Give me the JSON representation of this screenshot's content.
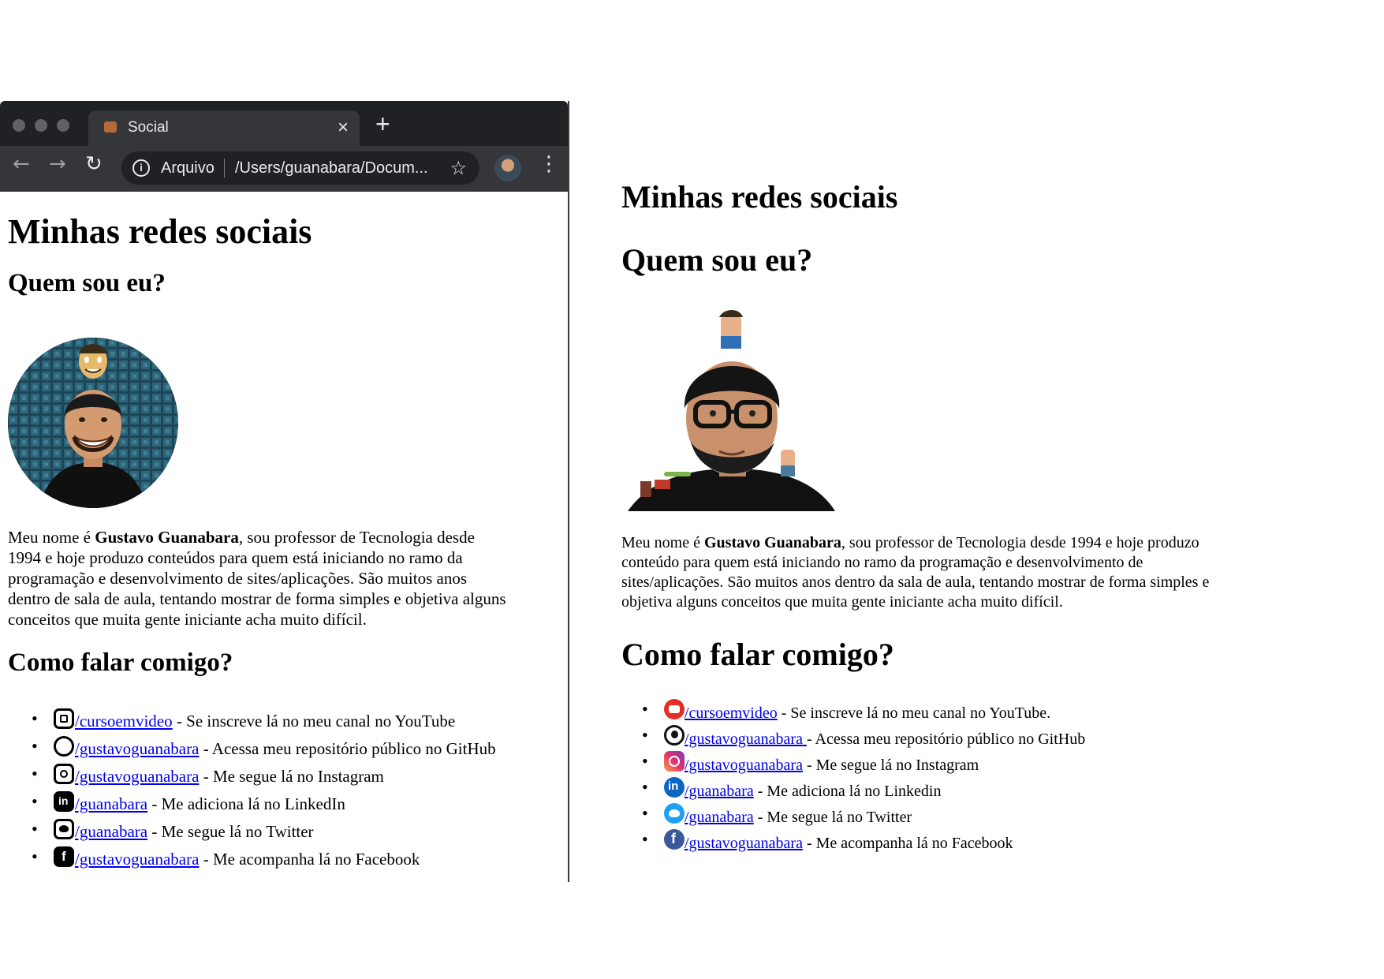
{
  "browser": {
    "tab_title": "Social",
    "address_label": "Arquivo",
    "address_url": "/Users/guanabara/Docum..."
  },
  "left": {
    "h1": "Minhas redes sociais",
    "h2_about": "Quem sou eu?",
    "bio_before": "Meu nome é ",
    "bio_name": "Gustavo Guanabara",
    "bio_line1": ", sou professor de Tecnologia desde",
    "bio_line2": "1994 e hoje produzo conteúdos para quem está iniciando no ramo da",
    "bio_line3": "programação e desenvolvimento de sites/aplicações. São muitos anos",
    "bio_line4": "dentro de sala de aula, tentando mostrar de forma simples e objetiva alguns",
    "bio_line5": "conceitos que muita gente iniciante acha muito difícil.",
    "h2_contact": "Como falar comigo?",
    "links": [
      {
        "icon": "youtube-icon",
        "handle": "/cursoemvideo",
        "text": " - Se inscreve lá no meu canal no YouTube"
      },
      {
        "icon": "github-icon",
        "handle": "/gustavoguanabara",
        "text": " - Acessa meu repositório público no GitHub"
      },
      {
        "icon": "instagram-icon",
        "handle": "/gustavoguanabara",
        "text": " - Me segue lá no Instagram"
      },
      {
        "icon": "linkedin-icon",
        "handle": "/guanabara",
        "text": " - Me adiciona lá no LinkedIn"
      },
      {
        "icon": "twitter-icon",
        "handle": "/guanabara",
        "text": " - Me segue lá no Twitter"
      },
      {
        "icon": "facebook-icon",
        "handle": "/gustavoguanabara",
        "text": " - Me acompanha lá no Facebook"
      }
    ]
  },
  "right": {
    "h1": "Minhas redes sociais",
    "h2_about": "Quem sou eu?",
    "bio_before": "Meu nome é ",
    "bio_name": "Gustavo Guanabara",
    "bio_line1": ", sou professor de Tecnologia desde 1994 e hoje produzo",
    "bio_line2": "conteúdo para quem está iniciando no ramo da programação e desenvolvimento de",
    "bio_line3": "sites/aplicações. São muitos anos dentro da sala de aula, tentando mostrar de forma simples e",
    "bio_line4": "objetiva alguns conceitos que muita gente iniciante acha muito difícil.",
    "h2_contact": "Como falar comigo?",
    "links": [
      {
        "icon": "youtube-icon",
        "handle": "/cursoemvideo",
        "text": " - Se inscreve lá no meu canal no YouTube."
      },
      {
        "icon": "github-icon",
        "handle": "/gustavoguanabara ",
        "text": "- Acessa meu repositório público no GitHub"
      },
      {
        "icon": "instagram-icon",
        "handle": "/gustavoguanabara",
        "text": " - Me segue lá no Instagram"
      },
      {
        "icon": "linkedin-icon",
        "handle": "/guanabara",
        "text": " - Me adiciona lá no Linkedin"
      },
      {
        "icon": "twitter-icon",
        "handle": "/guanabara",
        "text": " - Me segue lá no Twitter"
      },
      {
        "icon": "facebook-icon",
        "handle": "/gustavoguanabara",
        "text": " - Me acompanha lá no Facebook"
      }
    ]
  },
  "colors": {
    "browser_frame": "#202124",
    "link_left": "#0000ee",
    "link_right": "#551a8b",
    "youtube": "#e52d27",
    "linkedin": "#0a66c2",
    "twitter": "#1da1f2",
    "facebook": "#3b5998"
  }
}
